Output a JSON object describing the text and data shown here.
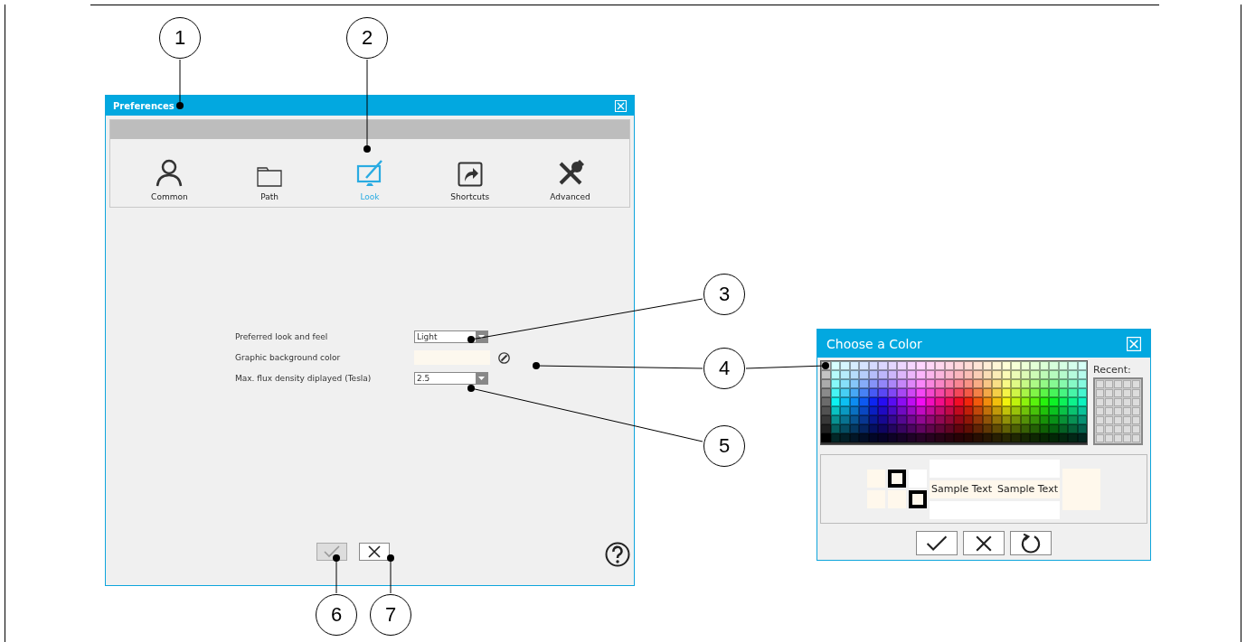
{
  "callouts": [
    {
      "number": "1"
    },
    {
      "number": "2"
    },
    {
      "number": "3"
    },
    {
      "number": "4"
    },
    {
      "number": "5"
    },
    {
      "number": "6"
    },
    {
      "number": "7"
    }
  ],
  "preferences": {
    "title": "Preferences",
    "tabs": [
      {
        "label": "Common",
        "selected": false
      },
      {
        "label": "Path",
        "selected": false
      },
      {
        "label": "Look",
        "selected": true
      },
      {
        "label": "Shortcuts",
        "selected": false
      },
      {
        "label": "Advanced",
        "selected": false
      }
    ],
    "settings": [
      {
        "kind": "dropdown",
        "label": "Preferred look and feel",
        "value": "Light"
      },
      {
        "kind": "color",
        "label": "Graphic background color"
      },
      {
        "kind": "dropdown",
        "label": "Max. flux density diplayed (Tesla)",
        "value": "2.5"
      }
    ],
    "buttons": [
      {
        "kind": "ok",
        "disabled": true
      },
      {
        "kind": "cancel",
        "disabled": false
      }
    ]
  },
  "color_dialog": {
    "title": "Choose a Color",
    "recent_label": "Recent:",
    "sample_texts": [
      "Sample Text",
      "Sample Text"
    ],
    "buttons": [
      {
        "kind": "ok"
      },
      {
        "kind": "cancel"
      },
      {
        "kind": "reset"
      }
    ]
  }
}
